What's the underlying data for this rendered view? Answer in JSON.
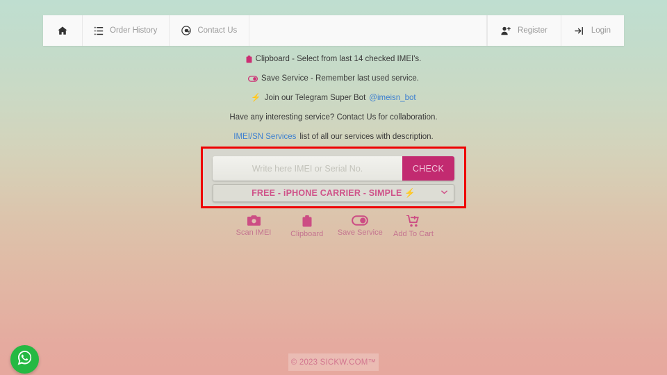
{
  "navbar": {
    "left_items": [
      {
        "label": "",
        "icon": "home-icon",
        "name": "home"
      },
      {
        "label": "Order History",
        "icon": "list-icon",
        "name": "order-history"
      },
      {
        "label": "Contact Us",
        "icon": "at-sign-icon",
        "name": "contact-us"
      }
    ],
    "right_items": [
      {
        "label": "Register",
        "icon": "user-plus-icon",
        "name": "register"
      },
      {
        "label": "Login",
        "icon": "sign-in-icon",
        "name": "login"
      }
    ]
  },
  "info_lines": [
    {
      "icon": "clipboard-icon",
      "text": "Clipboard - Select from last 14 checked IMEI's."
    },
    {
      "icon": "toggle-icon",
      "text": "Save Service - Remember last used service."
    },
    {
      "icon": "zap-emoji",
      "emoji": "⚡",
      "text": "Join our Telegram Super Bot",
      "link": "@imeisn_bot"
    },
    {
      "icon": "none",
      "text": "Have any interesting service? Contact Us for collaboration."
    },
    {
      "icon": "none",
      "link_first": "IMEI/SN Services",
      "text": "list of all our services with description."
    }
  ],
  "form": {
    "input_value": "",
    "input_placeholder": "Write here IMEI or Serial No.",
    "check_label": "CHECK",
    "selected_service": "FREE - iPHONE CARRIER - SIMPLE ⚡",
    "caret": "⌄"
  },
  "actions": [
    {
      "label": "Scan IMEI",
      "icon": "camera-icon"
    },
    {
      "label": "Clipboard",
      "icon": "clipboard-icon"
    },
    {
      "label": "Save Service",
      "icon": "toggle-icon"
    },
    {
      "label": "Add To Cart",
      "icon": "cart-plus-icon"
    }
  ],
  "footer": {
    "text": "© 2023 SICKW.COM™"
  },
  "floating": {
    "whatsapp_label": "WhatsApp"
  },
  "colors": {
    "accent_pink": "#c22a70",
    "service_pink": "#cf5289",
    "link_blue": "#3c7fd0",
    "highlight_red": "#ee0000",
    "whatsapp_green": "#25b943"
  }
}
